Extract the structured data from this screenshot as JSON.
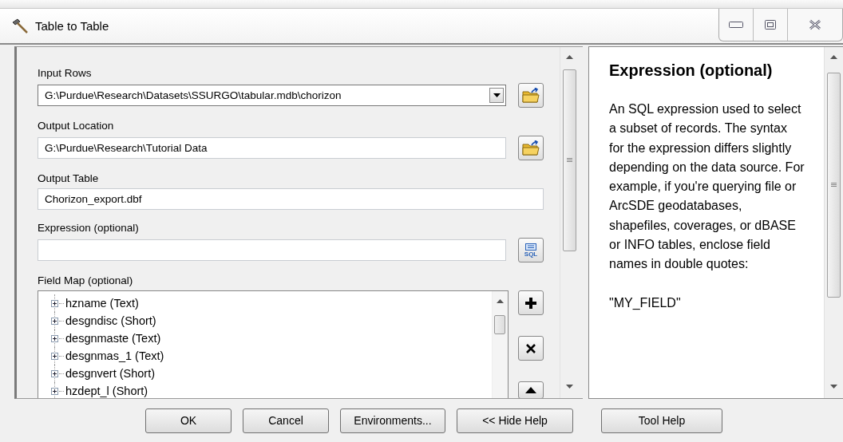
{
  "window": {
    "title": "Table to Table"
  },
  "parameters": [
    {
      "kind": "combo",
      "label": "Input Rows",
      "value": "G:\\Purdue\\Research\\Datasets\\SSURGO\\tabular.mdb\\chorizon"
    },
    {
      "kind": "path",
      "label": "Output Location",
      "value": "G:\\Purdue\\Research\\Tutorial Data"
    },
    {
      "kind": "text",
      "label": "Output Table",
      "value": "Chorizon_export.dbf"
    },
    {
      "kind": "sql",
      "label": "Expression (optional)",
      "button_text": "SQL"
    }
  ],
  "field_map": {
    "label": "Field Map (optional)",
    "items": [
      {
        "label": "hzname (Text)",
        "expanded": false
      },
      {
        "label": "desgndisc (Short)",
        "expanded": false
      },
      {
        "label": "desgnmaste (Text)",
        "expanded": false
      },
      {
        "label": "desgnmas_1 (Text)",
        "expanded": false
      },
      {
        "label": "desgnvert (Short)",
        "expanded": false
      },
      {
        "label": "hzdept_l (Short)",
        "expanded": false
      }
    ]
  },
  "help": {
    "title": "Expression (optional)",
    "paragraphs": [
      "An SQL expression used to select a subset of records. The syntax for the expression differs slightly depending on the data source. For example, if you're querying file or ArcSDE geodatabases, shapefiles, coverages, or dBASE or INFO tables, enclose field names in double quotes:",
      "\"MY_FIELD\""
    ]
  },
  "buttons": [
    "OK",
    "Cancel",
    "Environments...",
    "<< Hide Help",
    "Tool Help"
  ]
}
